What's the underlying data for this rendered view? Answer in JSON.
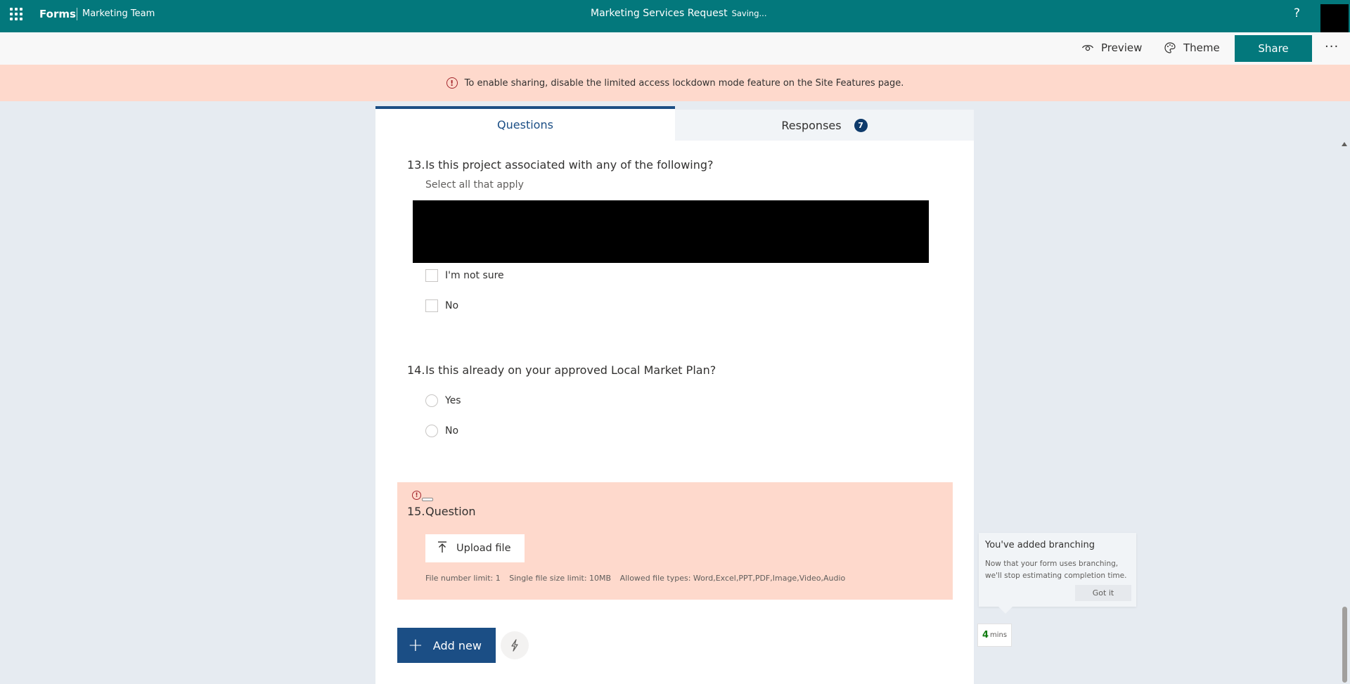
{
  "app": {
    "brand": "Forms",
    "team": "Marketing Team",
    "form_title": "Marketing Services Request",
    "status": "Saving...",
    "help_icon": "?"
  },
  "toolbar": {
    "preview_label": "Preview",
    "theme_label": "Theme",
    "share_label": "Share",
    "more_label": "···"
  },
  "banner": {
    "icon": "!",
    "message": "To enable sharing, disable the limited access lockdown mode feature on the Site Features page."
  },
  "tabs": {
    "questions_label": "Questions",
    "responses_label": "Responses",
    "responses_count": "7"
  },
  "questions": [
    {
      "number": "13.",
      "text": "Is this project associated with any of the following?",
      "subtitle": "Select all that apply",
      "options": [
        "I'm not sure",
        "No"
      ]
    },
    {
      "number": "14.",
      "text": "Is this already on your approved Local Market Plan?",
      "options": [
        "Yes",
        "No"
      ]
    },
    {
      "number": "15.",
      "text": "Question",
      "upload_label": "Upload file",
      "limits": [
        "File number limit: 1",
        "Single file size limit: 10MB",
        "Allowed file types: Word,Excel,PPT,PDF,Image,Video,Audio"
      ]
    }
  ],
  "add_new_label": "Add new",
  "tip": {
    "title": "You've added branching",
    "body": "Now that your form uses branching, we'll stop estimating completion time.",
    "button": "Got it"
  },
  "estimate": {
    "value": "4",
    "unit": "mins"
  },
  "colors": {
    "header": "#03787c",
    "banner": "#fed9cc",
    "accent": "#1b4e85",
    "error": "#a4262c"
  }
}
